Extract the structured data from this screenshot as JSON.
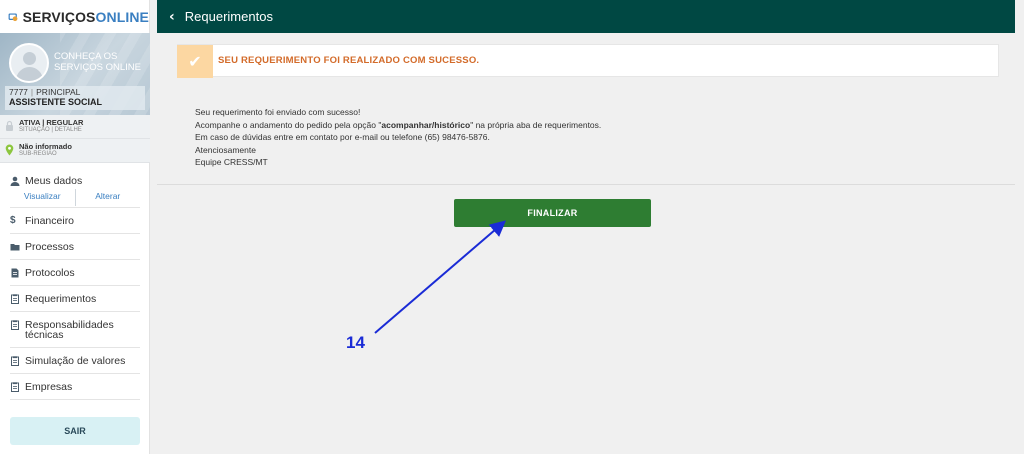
{
  "brand": {
    "part1": "SERVIÇOS",
    "part2": "ONLINE"
  },
  "profile": {
    "welcome_line1": "CONHEÇA OS",
    "welcome_line2": "SERVIÇOS ONLINE",
    "registration_number": "7777",
    "registration_type": "PRINCIPAL",
    "role": "ASSISTENTE SOCIAL"
  },
  "status": {
    "situation_value": "ATIVA | REGULAR",
    "situation_label": "SITUAÇÃO | DETALHE",
    "region_value": "Não informado",
    "region_label": "SUB-REGIÃO"
  },
  "menu": {
    "meus_dados": "Meus dados",
    "visualizar": "Visualizar",
    "alterar": "Alterar",
    "items": [
      {
        "label": "Financeiro",
        "icon": "dollar-icon"
      },
      {
        "label": "Processos",
        "icon": "folder-icon"
      },
      {
        "label": "Protocolos",
        "icon": "document-icon"
      },
      {
        "label": "Requerimentos",
        "icon": "clipboard-icon"
      },
      {
        "label": "Responsabilidades técnicas",
        "icon": "clipboard-icon"
      },
      {
        "label": "Simulação de valores",
        "icon": "clipboard-icon"
      },
      {
        "label": "Empresas",
        "icon": "clipboard-icon"
      }
    ],
    "logout": "SAIR"
  },
  "header": {
    "title": "Requerimentos"
  },
  "alert": {
    "message": "SEU REQUERIMENTO FOI REALIZADO COM SUCESSO."
  },
  "body": {
    "line1": "Seu requerimento foi enviado com sucesso!",
    "line2_pre": "Acompanhe o andamento do pedido pela opção \"",
    "line2_bold": "acompanhar/histórico",
    "line2_post": "\" na própria aba de requerimentos.",
    "line3": "Em caso de dúvidas entre em contato por e-mail ou telefone (65) 98476-5876.",
    "line4": "Atenciosamente",
    "line5": "Equipe CRESS/MT"
  },
  "actions": {
    "finalize": "FINALIZAR"
  },
  "annotation": {
    "label": "14",
    "color": "#1a2bd6"
  },
  "colors": {
    "header": "#004843",
    "finalize": "#2e7d32",
    "alert_text": "#d36b2a"
  }
}
